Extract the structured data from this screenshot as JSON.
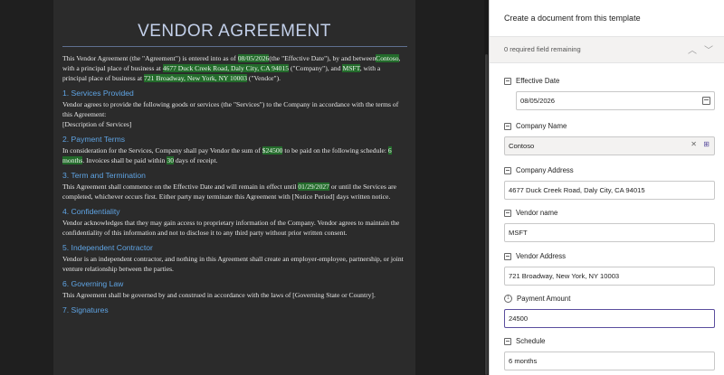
{
  "document": {
    "title": "VENDOR AGREEMENT",
    "intro": {
      "t1": "This Vendor Agreement (the \"Agreement\") is entered into as of ",
      "effective_date": "08/05/2026",
      "t2": "(the \"Effective Date\"), by and between",
      "company": "Contoso",
      "t3": ", with a principal place of business at ",
      "company_address": "4677 Duck Creek Road, Daly City, CA 94015",
      "t4": " (\"Company\"), and ",
      "vendor": "MSFT",
      "t5": ", with a principal place of business at ",
      "vendor_address": "721 Broadway, New York, NY 10003",
      "t6": " (\"Vendor\")."
    },
    "s1": {
      "heading": "1. Services Provided",
      "text": "Vendor agrees to provide the following goods or services (the \"Services\") to the Company in accordance with the terms of this Agreement:",
      "placeholder": "[Description of Services]"
    },
    "s2": {
      "heading": "2. Payment Terms",
      "t1": "In consideration for the Services, Company shall pay Vendor the sum of ",
      "amount": "$24500",
      "t2": " to be paid on the following schedule: ",
      "schedule": "6 months",
      "t3": ". Invoices shall be paid within ",
      "days": "30",
      "t4": " days of receipt."
    },
    "s3": {
      "heading": "3. Term and Termination",
      "t1": "This Agreement shall commence on the Effective Date and will remain in effect until ",
      "end_date": "01/29/2027",
      "t2": " or until the Services are completed, whichever occurs first. Either party may terminate this Agreement with [Notice Period] days written notice."
    },
    "s4": {
      "heading": "4. Confidentiality",
      "text": "Vendor acknowledges that they may gain access to proprietary information of the Company. Vendor agrees to maintain the confidentiality of this information and not to disclose it to any third party without prior written consent."
    },
    "s5": {
      "heading": "5. Independent Contractor",
      "text": "Vendor is an independent contractor, and nothing in this Agreement shall create an employer-employee, partnership, or joint venture relationship between the parties."
    },
    "s6": {
      "heading": "6. Governing Law",
      "text": "This Agreement shall be governed by and construed in accordance with the laws of [Governing State or Country]."
    },
    "s7": {
      "heading": "7. Signatures"
    }
  },
  "panel": {
    "title": "Create a document from this template",
    "required_remaining": "0 required field remaining",
    "fields": {
      "effective_date": {
        "label": "Effective Date",
        "value": "08/05/2026",
        "icon": "calendar-icon"
      },
      "company_name": {
        "label": "Company Name",
        "value": "Contoso",
        "icon": "text-field-icon"
      },
      "company_address": {
        "label": "Company Address",
        "value": "4677 Duck Creek Road, Daly City, CA 94015",
        "icon": "text-field-icon"
      },
      "vendor_name": {
        "label": "Vendor name",
        "value": "MSFT",
        "icon": "text-field-icon"
      },
      "vendor_address": {
        "label": "Vendor Address",
        "value": "721 Broadway, New York, NY 10003",
        "icon": "text-field-icon"
      },
      "payment_amount": {
        "label": "Payment Amount",
        "value": "24500",
        "icon": "number-info-icon"
      },
      "schedule": {
        "label": "Schedule",
        "value": "6 months",
        "icon": "text-field-icon"
      }
    }
  },
  "colors": {
    "highlight": "#236b2b",
    "heading": "#5fa4e4",
    "focus_border": "#5b4e9e"
  }
}
